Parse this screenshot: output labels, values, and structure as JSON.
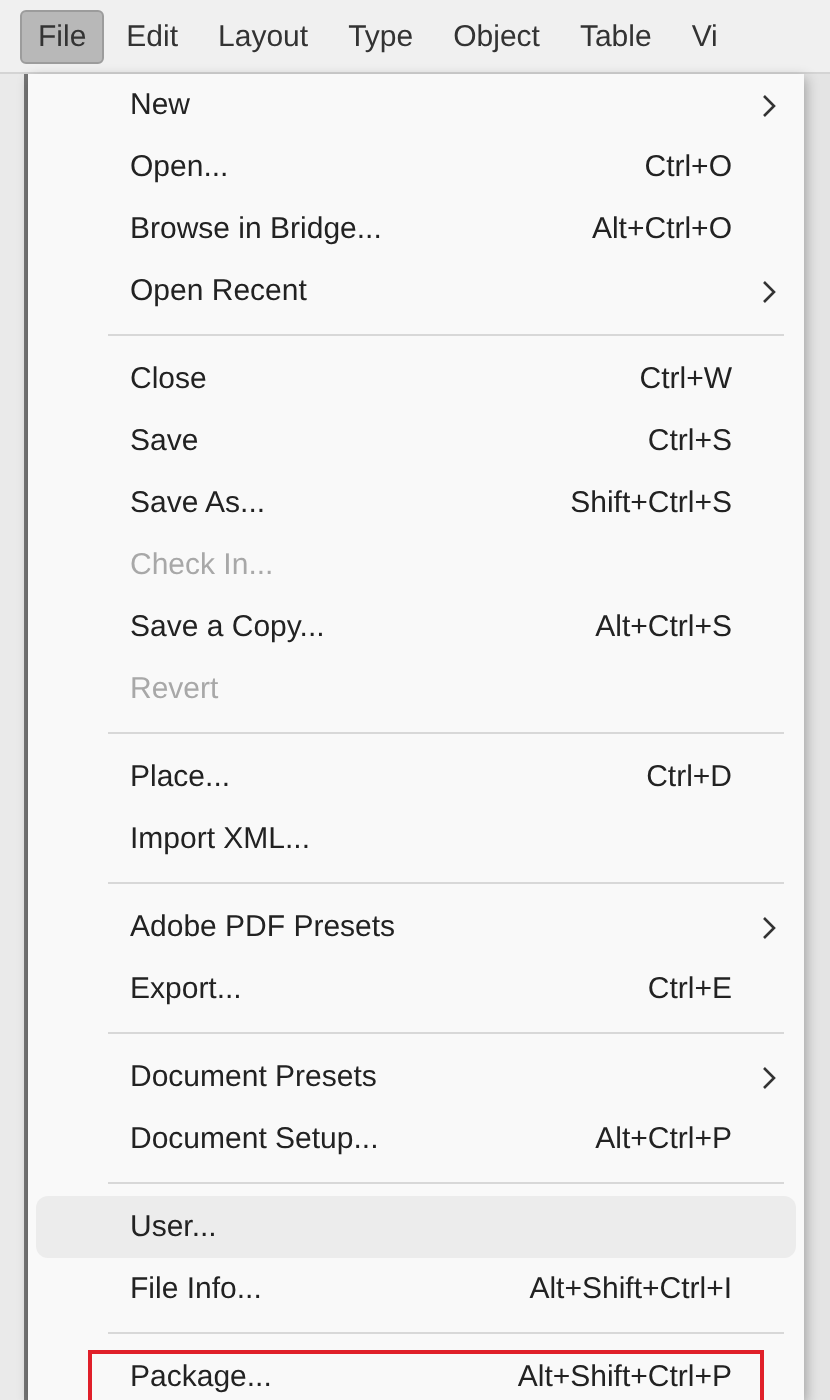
{
  "menubar": [
    {
      "label": "File",
      "selected": true
    },
    {
      "label": "Edit",
      "selected": false
    },
    {
      "label": "Layout",
      "selected": false
    },
    {
      "label": "Type",
      "selected": false
    },
    {
      "label": "Object",
      "selected": false
    },
    {
      "label": "Table",
      "selected": false
    },
    {
      "label": "Vi",
      "selected": false
    }
  ],
  "menu": [
    {
      "kind": "item",
      "label": "New",
      "submenu": true,
      "disabled": false,
      "highlighted": false,
      "annotated": false
    },
    {
      "kind": "item",
      "label": "Open...",
      "shortcut": "Ctrl+O",
      "submenu": false,
      "disabled": false,
      "highlighted": false,
      "annotated": false
    },
    {
      "kind": "item",
      "label": "Browse in Bridge...",
      "shortcut": "Alt+Ctrl+O",
      "submenu": false,
      "disabled": false,
      "highlighted": false,
      "annotated": false
    },
    {
      "kind": "item",
      "label": "Open Recent",
      "submenu": true,
      "disabled": false,
      "highlighted": false,
      "annotated": false
    },
    {
      "kind": "separator"
    },
    {
      "kind": "item",
      "label": "Close",
      "shortcut": "Ctrl+W",
      "submenu": false,
      "disabled": false,
      "highlighted": false,
      "annotated": false
    },
    {
      "kind": "item",
      "label": "Save",
      "shortcut": "Ctrl+S",
      "submenu": false,
      "disabled": false,
      "highlighted": false,
      "annotated": false
    },
    {
      "kind": "item",
      "label": "Save As...",
      "shortcut": "Shift+Ctrl+S",
      "submenu": false,
      "disabled": false,
      "highlighted": false,
      "annotated": false
    },
    {
      "kind": "item",
      "label": "Check In...",
      "submenu": false,
      "disabled": true,
      "highlighted": false,
      "annotated": false
    },
    {
      "kind": "item",
      "label": "Save a Copy...",
      "shortcut": "Alt+Ctrl+S",
      "submenu": false,
      "disabled": false,
      "highlighted": false,
      "annotated": false
    },
    {
      "kind": "item",
      "label": "Revert",
      "submenu": false,
      "disabled": true,
      "highlighted": false,
      "annotated": false
    },
    {
      "kind": "separator"
    },
    {
      "kind": "item",
      "label": "Place...",
      "shortcut": "Ctrl+D",
      "submenu": false,
      "disabled": false,
      "highlighted": false,
      "annotated": false
    },
    {
      "kind": "item",
      "label": "Import XML...",
      "submenu": false,
      "disabled": false,
      "highlighted": false,
      "annotated": false
    },
    {
      "kind": "separator"
    },
    {
      "kind": "item",
      "label": "Adobe PDF Presets",
      "submenu": true,
      "disabled": false,
      "highlighted": false,
      "annotated": false
    },
    {
      "kind": "item",
      "label": "Export...",
      "shortcut": "Ctrl+E",
      "submenu": false,
      "disabled": false,
      "highlighted": false,
      "annotated": false
    },
    {
      "kind": "separator"
    },
    {
      "kind": "item",
      "label": "Document Presets",
      "submenu": true,
      "disabled": false,
      "highlighted": false,
      "annotated": false
    },
    {
      "kind": "item",
      "label": "Document Setup...",
      "shortcut": "Alt+Ctrl+P",
      "submenu": false,
      "disabled": false,
      "highlighted": false,
      "annotated": false
    },
    {
      "kind": "separator"
    },
    {
      "kind": "item",
      "label": "User...",
      "submenu": false,
      "disabled": false,
      "highlighted": true,
      "annotated": false
    },
    {
      "kind": "item",
      "label": "File Info...",
      "shortcut": "Alt+Shift+Ctrl+I",
      "submenu": false,
      "disabled": false,
      "highlighted": false,
      "annotated": false
    },
    {
      "kind": "separator"
    },
    {
      "kind": "item",
      "label": "Package...",
      "shortcut": "Alt+Shift+Ctrl+P",
      "submenu": false,
      "disabled": false,
      "highlighted": false,
      "annotated": true
    }
  ]
}
